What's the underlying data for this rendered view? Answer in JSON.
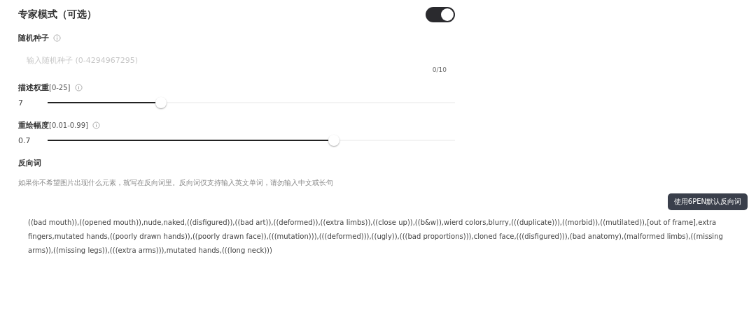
{
  "expert_mode": {
    "label": "专家模式（可选）",
    "on": true
  },
  "seed": {
    "label": "随机种子",
    "placeholder": "输入随机种子 (0-4294967295)",
    "counter": "0/10"
  },
  "sliders": [
    {
      "label": "描述权重",
      "range": "[0-25]",
      "reading": "7",
      "level": 0.28
    },
    {
      "label": "重绘幅度",
      "range": "[0.01-0.99]",
      "reading": "0.7",
      "level": 0.705
    }
  ],
  "negative": {
    "label": "反向词",
    "hint": "如果你不希望图片出现什么元素，就写在反向词里。反向词仅支持输入英文单词，请勿输入中文或长句",
    "button": "使用6PEN默认反向词",
    "value": "((bad mouth)),((opened mouth)),nude,naked,((disfigured)),((bad art)),((deformed)),((extra limbs)),((close up)),((b&w)),wierd colors,blurry,(((duplicate))),((morbid)),((mutilated)),[out of frame],extra fingers,mutated hands,((poorly drawn hands)),((poorly drawn face)),(((mutation))),(((deformed))),((ugly)),(((bad proportions))),cloned face,(((disfigured))),(bad anatomy),(malformed limbs),((missing arms)),((missing legs)),(((extra arms))),mutated hands,(((long neck)))"
  }
}
